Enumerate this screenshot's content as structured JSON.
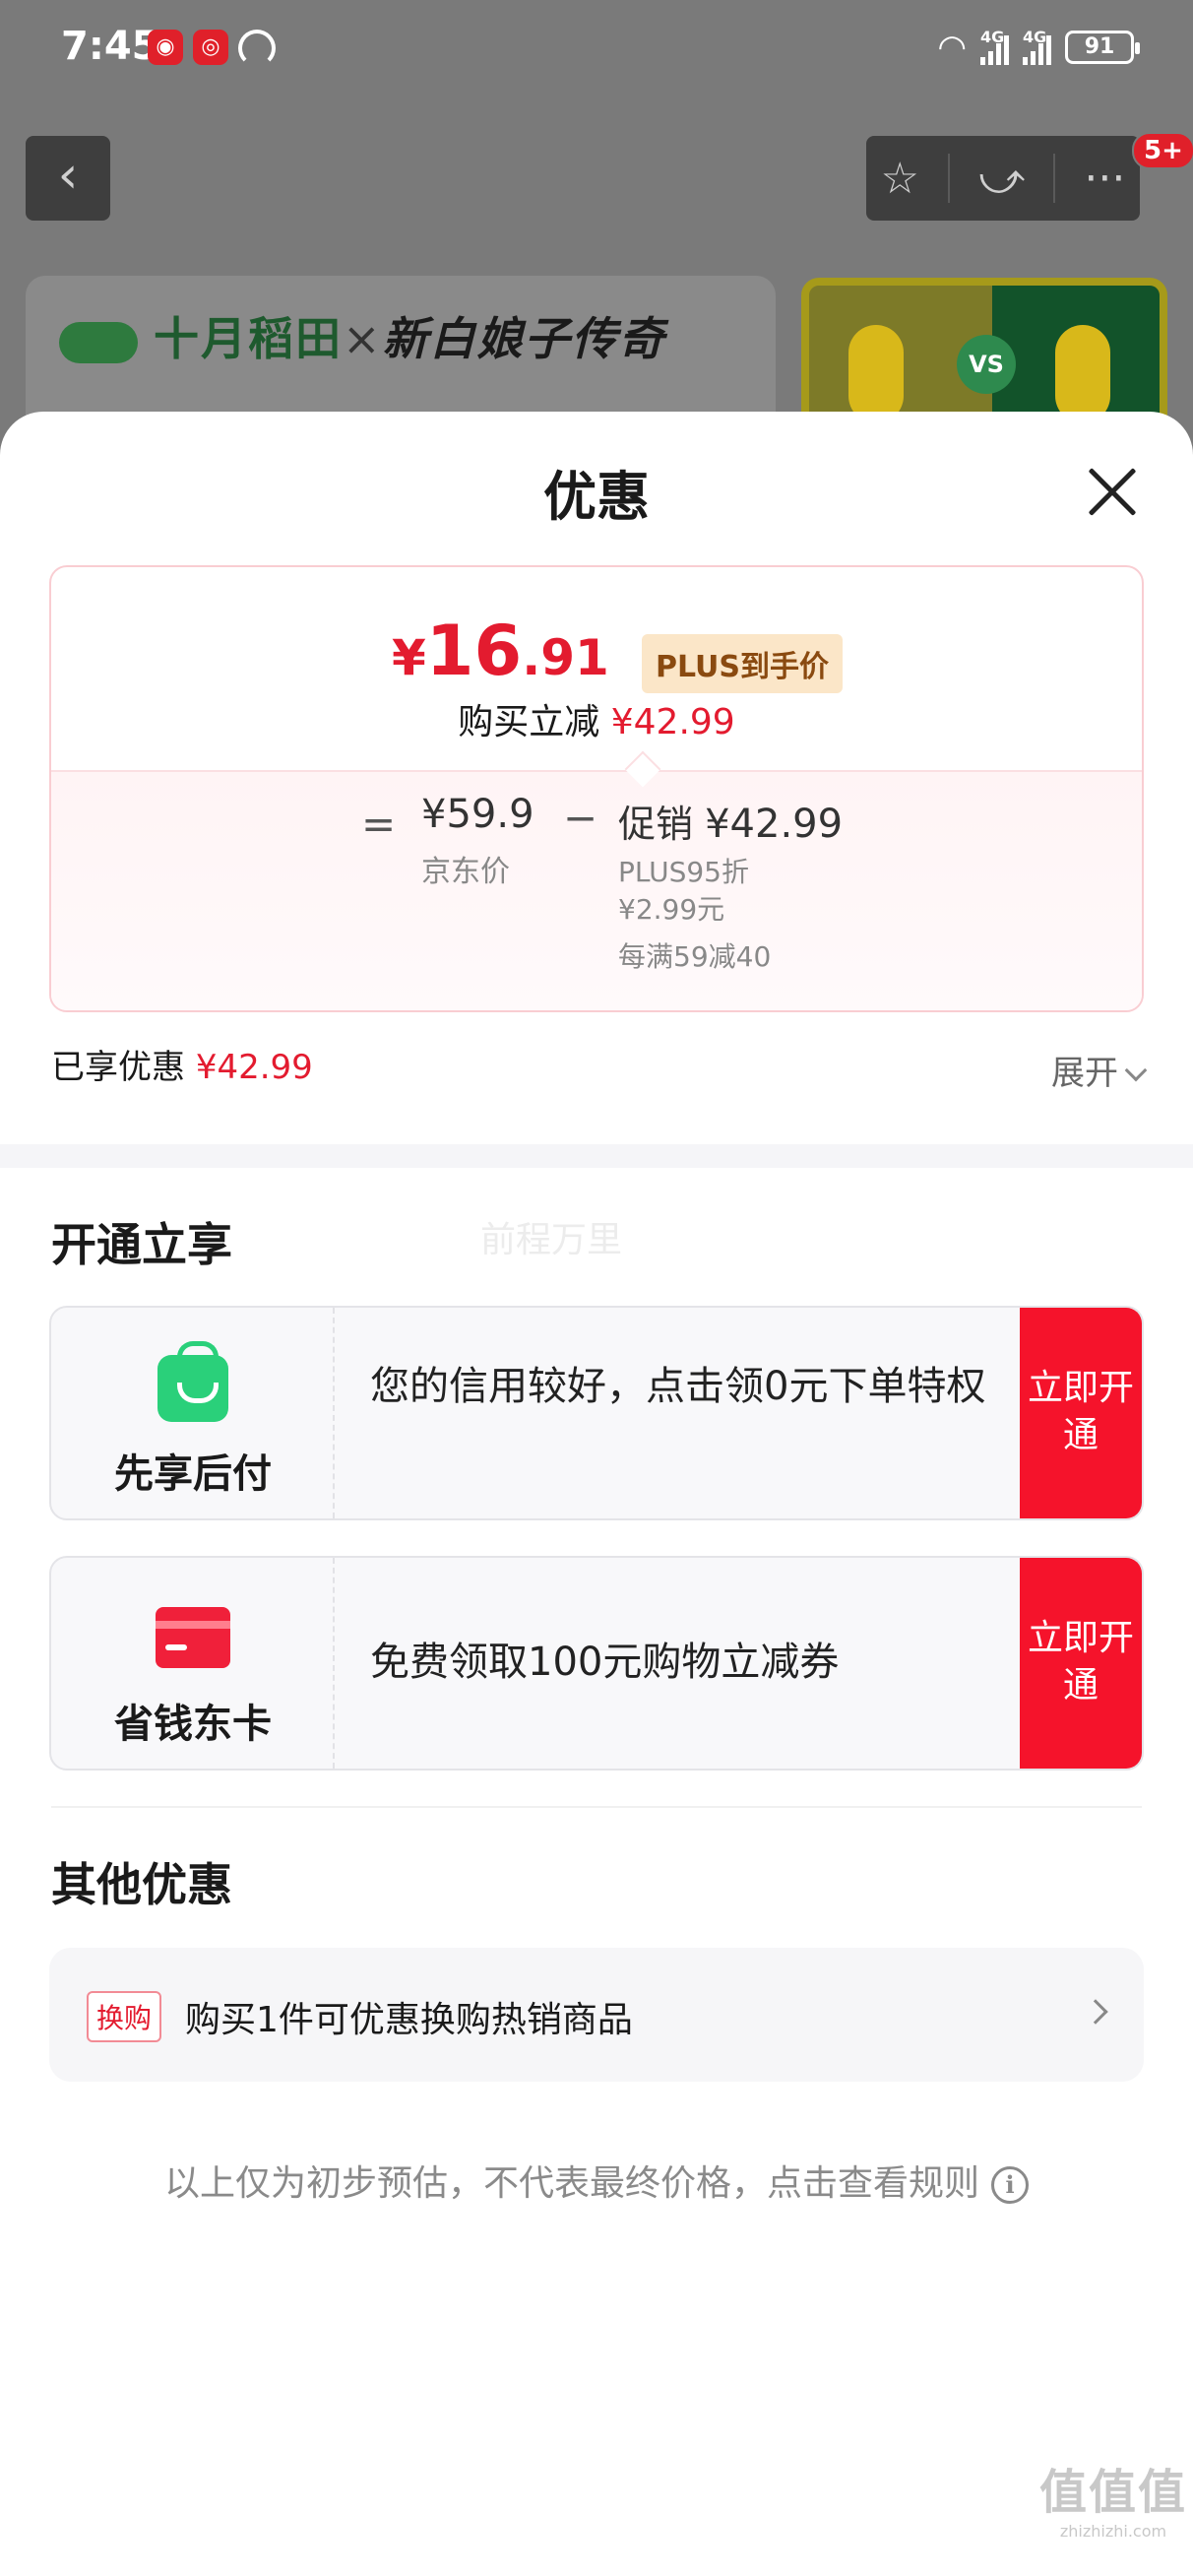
{
  "status_bar": {
    "time": "7:45",
    "signal_1": "4G",
    "signal_2": "4G",
    "battery": "91",
    "notification_count": "5+"
  },
  "nav": {
    "back_icon": "‹",
    "star_icon": "☆",
    "share_icon": "⤻",
    "more_icon": "···"
  },
  "banner": {
    "brand": "十月稻田",
    "x": "×",
    "collab": "新白娘子传奇",
    "vs": "VS"
  },
  "sheet": {
    "title": "优惠",
    "price_card": {
      "currency": "¥",
      "final_int": "16",
      "final_dec": ".91",
      "plus_tag": "PLUS到手价",
      "reduce_label": "购买立减",
      "reduce_amount": "¥42.99",
      "eq": "=",
      "base_price": "¥59.9",
      "base_label": "京东价",
      "minus": "−",
      "promo_label": "促销",
      "promo_amount": "¥42.99",
      "promo_items": [
        "PLUS95折",
        "¥2.99元",
        "每满59减40"
      ]
    },
    "enjoyed_label": "已享优惠",
    "enjoyed_amount": "¥42.99",
    "expand_label": "展开",
    "open_section_title": "开通立享",
    "watermark": "前程万里",
    "services": [
      {
        "name": "先享后付",
        "desc": "您的信用较好，点击领0元下单特权",
        "button": "立即开通",
        "icon": "bag-icon",
        "icon_color": "#2ad07a"
      },
      {
        "name": "省钱东卡",
        "desc": "免费领取100元购物立减券",
        "button": "立即开通",
        "icon": "card-icon",
        "icon_color": "#f0203a"
      }
    ],
    "other_section_title": "其他优惠",
    "other_item": {
      "tag": "换购",
      "text": "购买1件可优惠换购热销商品"
    },
    "footer_note": "以上仅为初步预估，不代表最终价格，点击查看规则",
    "info_icon": "i"
  },
  "corner_mark": {
    "big": "值值值",
    "small": "zhizhizhi.com"
  },
  "colors": {
    "accent": "#e31b2f",
    "button": "#f5132b",
    "plus_tag_bg": "#fbe6c8"
  }
}
